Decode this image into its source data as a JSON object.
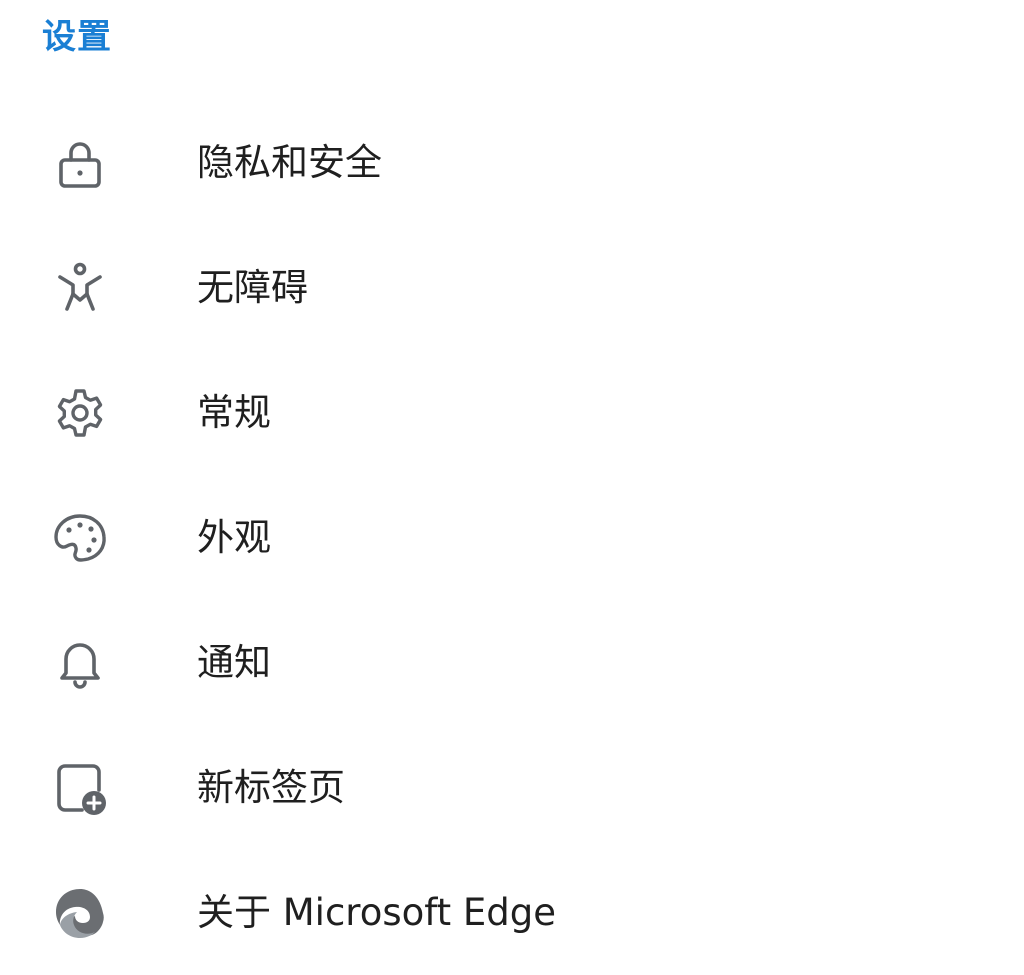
{
  "header": {
    "title": "设置"
  },
  "menu": {
    "items": [
      {
        "label": "隐私和安全",
        "icon": "lock-icon"
      },
      {
        "label": "无障碍",
        "icon": "accessibility-icon"
      },
      {
        "label": "常规",
        "icon": "gear-icon"
      },
      {
        "label": "外观",
        "icon": "palette-icon"
      },
      {
        "label": "通知",
        "icon": "bell-icon"
      },
      {
        "label": "新标签页",
        "icon": "new-tab-icon"
      },
      {
        "label": "关于 Microsoft Edge",
        "icon": "edge-logo-icon"
      }
    ]
  },
  "colors": {
    "accent": "#1a7fd4",
    "text": "#1f1f1f",
    "icon": "#5f6368",
    "background": "#ffffff"
  }
}
